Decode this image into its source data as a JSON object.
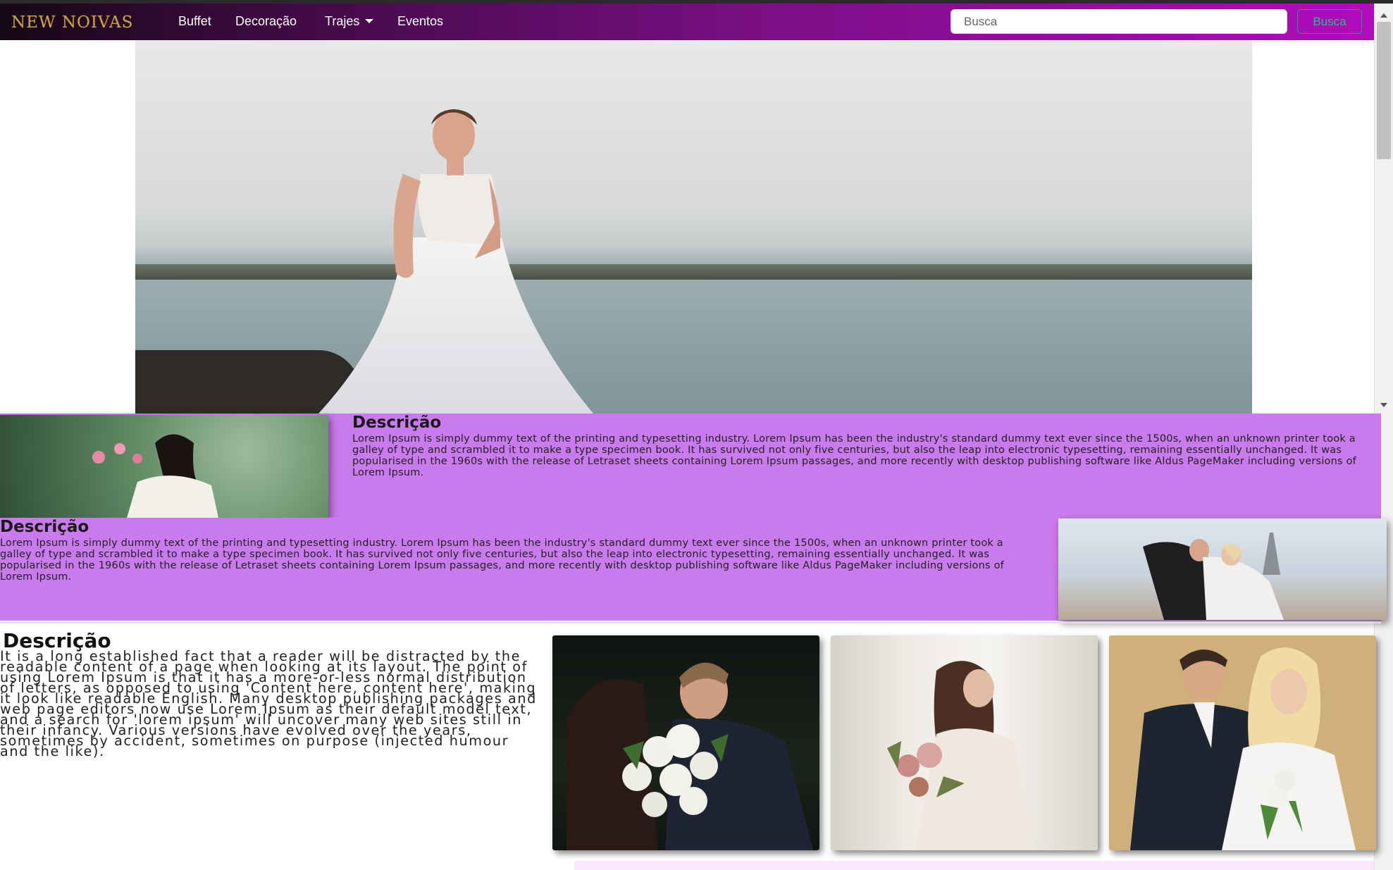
{
  "navbar": {
    "brand": "NEW NOIVAS",
    "links": [
      "Buffet",
      "Decoração",
      "Trajes",
      "Eventos"
    ],
    "search_placeholder": "Busca",
    "search_button": "Busca"
  },
  "sections": [
    {
      "title": "Descrição",
      "text": "Lorem Ipsum is simply dummy text of the printing and typesetting industry. Lorem Ipsum has been the industry's standard dummy text ever since the 1500s, when an unknown printer took a galley of type and scrambled it to make a type specimen book. It has survived not only five centuries, but also the leap into electronic typesetting, remaining essentially unchanged. It was popularised in the 1960s with the release of Letraset sheets containing Lorem Ipsum passages, and more recently with desktop publishing software like Aldus PageMaker including versions of Lorem Ipsum."
    },
    {
      "title": "Descrição",
      "text": "Lorem Ipsum is simply dummy text of the printing and typesetting industry. Lorem Ipsum has been the industry's standard dummy text ever since the 1500s, when an unknown printer took a galley of type and scrambled it to make a type specimen book. It has survived not only five centuries, but also the leap into electronic typesetting, remaining essentially unchanged. It was popularised in the 1960s with the release of Letraset sheets containing Lorem Ipsum passages, and more recently with desktop publishing software like Aldus PageMaker including versions of Lorem Ipsum."
    },
    {
      "title": "Descrição",
      "text": "It is a long established fact that a reader will be distracted by the readable content of a page when looking at its layout. The point of using Lorem Ipsum is that it has a more-or-less normal distribution of letters, as opposed to using 'Content here, content here', making it look like readable English. Many desktop publishing packages and web page editors now use Lorem Ipsum as their default model text, and a search for 'lorem ipsum' will uncover many web sites still in their infancy. Various versions have evolved over the years, sometimes by accident, sometimes on purpose (injected humour and the like)."
    }
  ],
  "colors": {
    "navbar_gradient_start": "#160816",
    "navbar_gradient_end": "#b00bbd",
    "band_purple": "#c97aec",
    "brand_gold": "#c9a24a",
    "search_button_green": "#27c07f"
  }
}
